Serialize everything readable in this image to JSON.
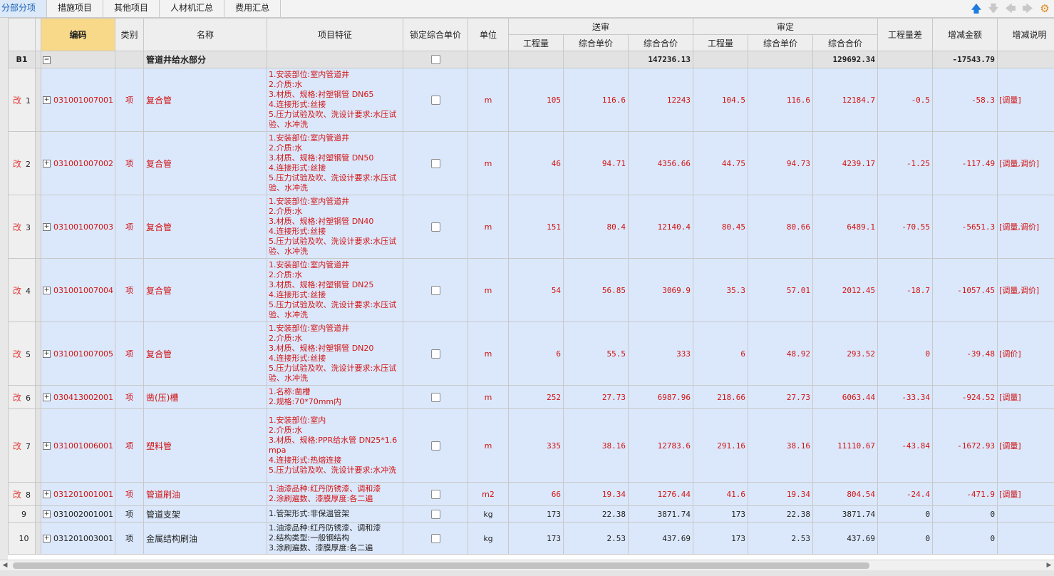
{
  "tabs": [
    {
      "label": "分部分项",
      "active": true
    },
    {
      "label": "措施项目",
      "active": false
    },
    {
      "label": "其他项目",
      "active": false
    },
    {
      "label": "人材机汇总",
      "active": false
    },
    {
      "label": "费用汇总",
      "active": false
    }
  ],
  "nav_icons": [
    "arrow-up-icon",
    "arrow-down-icon",
    "arrow-left-icon",
    "arrow-right-icon",
    "settings-icon"
  ],
  "colors": {
    "changed_text": "#d21414",
    "row_bg": "#dbe8fb",
    "header_highlight": "#f8d98a",
    "active_tab": "#1a5fb4"
  },
  "headers": {
    "code": "编码",
    "category": "类别",
    "name": "名称",
    "features": "项目特征",
    "lock": "锁定综合单价",
    "unit": "单位",
    "submitted": "送审",
    "approved": "审定",
    "qty": "工程量",
    "unit_price": "综合单价",
    "total": "综合合价",
    "qty_diff": "工程量差",
    "amount_change": "增减金额",
    "change_note": "增减说明"
  },
  "group": {
    "rn": "B1",
    "name": "管道井给水部分",
    "sub_total": "147236.13",
    "app_total": "129692.34",
    "change": "-17543.79"
  },
  "rows": [
    {
      "rn": "1",
      "chg": "改",
      "code": "031001007001",
      "cat": "项",
      "name": "复合管",
      "feat": "1.安装部位:室内管道井\n2.介质:水\n3.材质、规格:衬塑钢管 DN65\n4.连接形式:丝接\n5.压力试验及吹、洗设计要求:水压试验、水冲洗",
      "unit": "m",
      "sq": "105",
      "sp": "116.6",
      "st": "12243",
      "aq": "104.5",
      "ap": "116.6",
      "at": "12184.7",
      "diff": "-0.5",
      "amt": "-58.3",
      "note": "[调量]"
    },
    {
      "rn": "2",
      "chg": "改",
      "code": "031001007002",
      "cat": "项",
      "name": "复合管",
      "feat": "1.安装部位:室内管道井\n2.介质:水\n3.材质、规格:衬塑钢管 DN50\n4.连接形式:丝接\n5.压力试验及吹、洗设计要求:水压试验、水冲洗",
      "unit": "m",
      "sq": "46",
      "sp": "94.71",
      "st": "4356.66",
      "aq": "44.75",
      "ap": "94.73",
      "at": "4239.17",
      "diff": "-1.25",
      "amt": "-117.49",
      "note": "[调量,调价]"
    },
    {
      "rn": "3",
      "chg": "改",
      "code": "031001007003",
      "cat": "项",
      "name": "复合管",
      "feat": "1.安装部位:室内管道井\n2.介质:水\n3.材质、规格:衬塑钢管 DN40\n4.连接形式:丝接\n5.压力试验及吹、洗设计要求:水压试验、水冲洗",
      "unit": "m",
      "sq": "151",
      "sp": "80.4",
      "st": "12140.4",
      "aq": "80.45",
      "ap": "80.66",
      "at": "6489.1",
      "diff": "-70.55",
      "amt": "-5651.3",
      "note": "[调量,调价]"
    },
    {
      "rn": "4",
      "chg": "改",
      "code": "031001007004",
      "cat": "项",
      "name": "复合管",
      "feat": "1.安装部位:室内管道井\n2.介质:水\n3.材质、规格:衬塑钢管 DN25\n4.连接形式:丝接\n5.压力试验及吹、洗设计要求:水压试验、水冲洗",
      "unit": "m",
      "sq": "54",
      "sp": "56.85",
      "st": "3069.9",
      "aq": "35.3",
      "ap": "57.01",
      "at": "2012.45",
      "diff": "-18.7",
      "amt": "-1057.45",
      "note": "[调量,调价]"
    },
    {
      "rn": "5",
      "chg": "改",
      "code": "031001007005",
      "cat": "项",
      "name": "复合管",
      "feat": "1.安装部位:室内管道井\n2.介质:水\n3.材质、规格:衬塑钢管 DN20\n4.连接形式:丝接\n5.压力试验及吹、洗设计要求:水压试验、水冲洗",
      "unit": "m",
      "sq": "6",
      "sp": "55.5",
      "st": "333",
      "aq": "6",
      "ap": "48.92",
      "at": "293.52",
      "diff": "0",
      "amt": "-39.48",
      "note": "[调价]"
    },
    {
      "rn": "6",
      "chg": "改",
      "code": "030413002001",
      "cat": "项",
      "name": "凿(压)槽",
      "feat": "1.名称:凿槽\n2.规格:70*70mm内",
      "unit": "m",
      "sq": "252",
      "sp": "27.73",
      "st": "6987.96",
      "aq": "218.66",
      "ap": "27.73",
      "at": "6063.44",
      "diff": "-33.34",
      "amt": "-924.52",
      "note": "[调量]"
    },
    {
      "rn": "7",
      "chg": "改",
      "code": "031001006001",
      "cat": "项",
      "name": "塑料管",
      "feat": "1.安装部位:室内\n2.介质:水\n3.材质、规格:PPR给水管 DN25*1.6mpa\n4.连接形式:热熔连接\n5.压力试验及吹、洗设计要求:水冲洗",
      "unit": "m",
      "sq": "335",
      "sp": "38.16",
      "st": "12783.6",
      "aq": "291.16",
      "ap": "38.16",
      "at": "11110.67",
      "diff": "-43.84",
      "amt": "-1672.93",
      "note": "[调量]"
    },
    {
      "rn": "8",
      "chg": "改",
      "code": "031201001001",
      "cat": "项",
      "name": "管道刷油",
      "feat": "1.油漆品种:红丹防锈漆、调和漆\n2.涂刷遍数、漆膜厚度:各二遍",
      "unit": "m2",
      "sq": "66",
      "sp": "19.34",
      "st": "1276.44",
      "aq": "41.6",
      "ap": "19.34",
      "at": "804.54",
      "diff": "-24.4",
      "amt": "-471.9",
      "note": "[调量]"
    },
    {
      "rn": "9",
      "chg": "",
      "code": "031002001001",
      "cat": "项",
      "name": "管道支架",
      "feat": "1.管架形式:非保温管架",
      "unit": "kg",
      "sq": "173",
      "sp": "22.38",
      "st": "3871.74",
      "aq": "173",
      "ap": "22.38",
      "at": "3871.74",
      "diff": "0",
      "amt": "0",
      "note": ""
    },
    {
      "rn": "10",
      "chg": "",
      "code": "031201003001",
      "cat": "项",
      "name": "金属结构刷油",
      "feat": "1.油漆品种:红丹防锈漆、调和漆\n2.结构类型:一般钢结构\n3.涂刷遍数、漆膜厚度:各二遍",
      "unit": "kg",
      "sq": "173",
      "sp": "2.53",
      "st": "437.69",
      "aq": "173",
      "ap": "2.53",
      "at": "437.69",
      "diff": "0",
      "amt": "0",
      "note": ""
    }
  ]
}
